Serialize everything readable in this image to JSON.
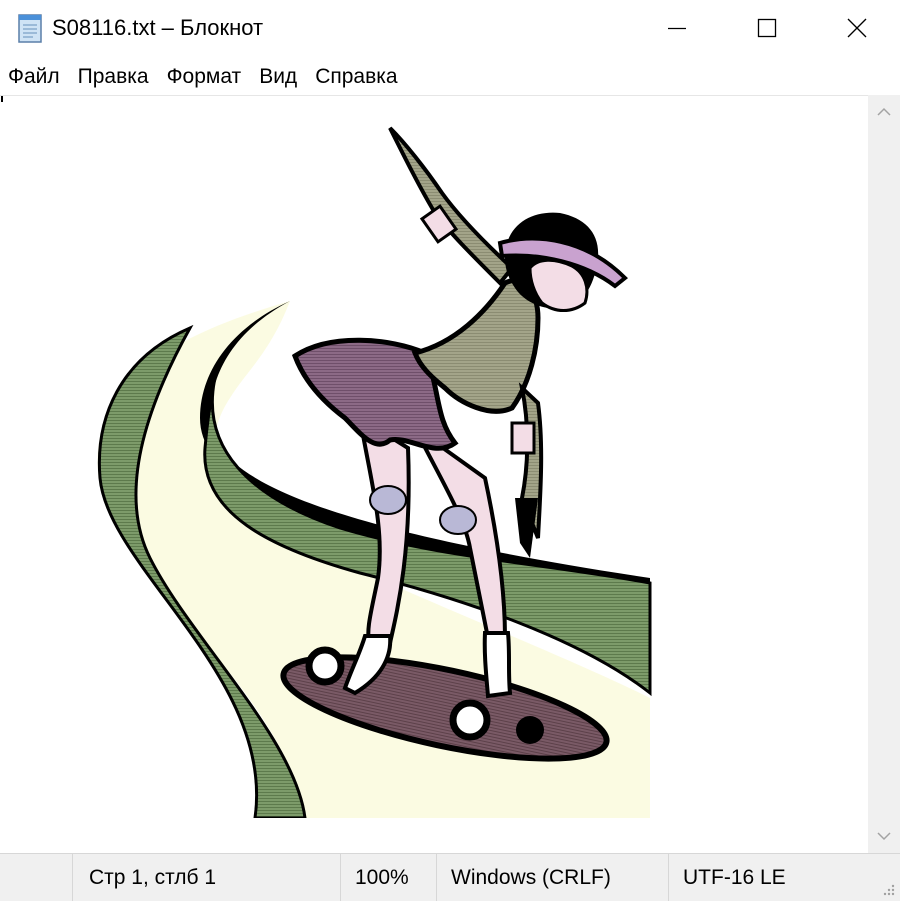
{
  "window": {
    "title": "S08116.txt – Блокнот",
    "icon": "notepad-icon",
    "controls": [
      "minimize-icon",
      "maximize-icon",
      "close-icon"
    ]
  },
  "menu": {
    "items": [
      {
        "label": "Файл"
      },
      {
        "label": "Правка"
      },
      {
        "label": "Формат"
      },
      {
        "label": "Вид"
      },
      {
        "label": "Справка"
      }
    ]
  },
  "editor": {
    "content": "clip-art illustration: skateboarder on a curved path",
    "scrollbar": [
      "scroll-up-icon",
      "scroll-down-icon"
    ]
  },
  "status": {
    "position": "Стр 1, стлб 1",
    "zoom": "100%",
    "line_endings": "Windows (CRLF)",
    "encoding": "UTF-16 LE"
  },
  "colors": {
    "path_green": "#7d9b6a",
    "path_cream": "#fbfbe2",
    "skirt_mauve": "#8c6a86",
    "skin_pink": "#f3dde6",
    "visor_lilac": "#c9a2cf",
    "board_brown": "#7a5a66"
  }
}
